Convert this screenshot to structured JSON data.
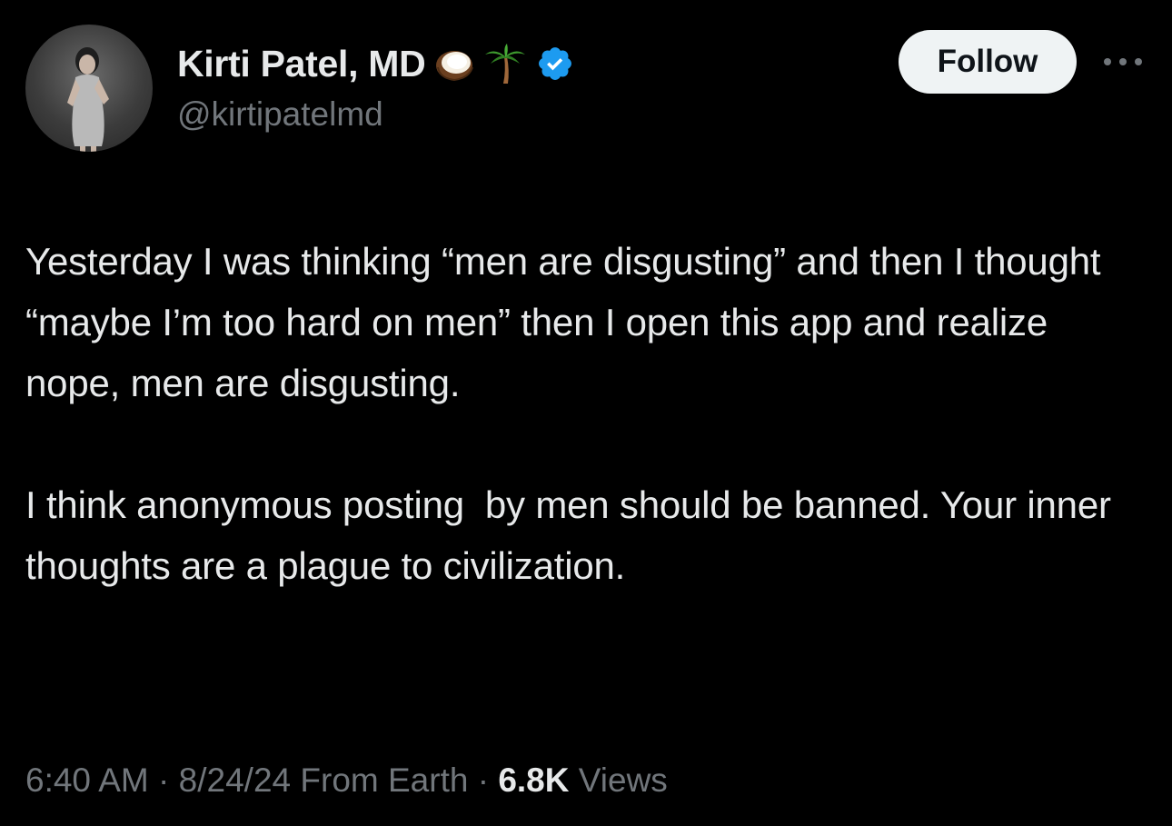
{
  "author": {
    "display_name": "Kirti Patel, MD",
    "handle": "@kirtipatelmd",
    "emojis": [
      "coconut-icon",
      "palm-tree-icon"
    ],
    "verified": true,
    "verified_color": "#1d9bf0"
  },
  "actions": {
    "follow_label": "Follow",
    "more_icon": "more-icon"
  },
  "tweet": {
    "paragraphs": [
      "Yesterday I was thinking “men are disgusting” and then I thought “maybe I’m too hard on men” then I open this app and realize nope, men are disgusting.",
      "I think anonymous posting  by men should be banned. Your inner thoughts are a plague to civilization."
    ]
  },
  "meta": {
    "time": "6:40 AM",
    "separator": "·",
    "date": "8/24/24",
    "location": "From Earth",
    "views_count": "6.8K",
    "views_label": "Views"
  },
  "colors": {
    "background": "#000000",
    "text_primary": "#e7e9ea",
    "text_secondary": "#71767b",
    "follow_bg": "#eff3f4",
    "follow_text": "#0f1419"
  }
}
